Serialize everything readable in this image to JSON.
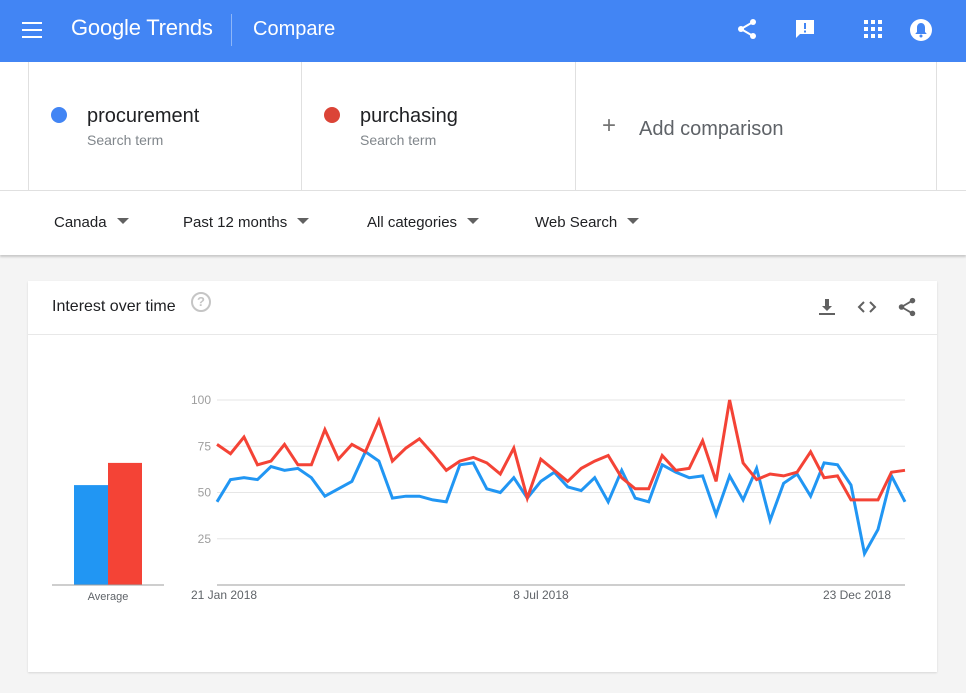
{
  "header": {
    "logo": "Google Trends",
    "title": "Compare",
    "icons": [
      "menu-icon",
      "share-icon",
      "feedback-icon",
      "apps-icon",
      "notifications-icon"
    ]
  },
  "terms": [
    {
      "name": "procurement",
      "subtitle": "Search term",
      "color": "#4285f4"
    },
    {
      "name": "purchasing",
      "subtitle": "Search term",
      "color": "#db4437"
    }
  ],
  "add_comparison": {
    "label": "Add comparison",
    "icon": "plus-icon"
  },
  "filters": {
    "region": "Canada",
    "time": "Past 12 months",
    "category": "All categories",
    "search_type": "Web Search"
  },
  "card": {
    "title": "Interest over time",
    "icons": [
      "help-icon",
      "download-icon",
      "embed-icon",
      "share-icon"
    ]
  },
  "chart_data": {
    "type": "line",
    "yticks": [
      25,
      50,
      75,
      100
    ],
    "ylim": [
      0,
      100
    ],
    "x_labels": [
      "21 Jan 2018",
      "8 Jul 2018",
      "23 Dec 2018"
    ],
    "average_label": "Average",
    "averages": [
      {
        "name": "procurement",
        "value": 54,
        "color": "#2196f3"
      },
      {
        "name": "purchasing",
        "value": 66,
        "color": "#f44336"
      }
    ],
    "series": [
      {
        "name": "procurement",
        "color": "#2196f3",
        "values": [
          45,
          57,
          58,
          57,
          64,
          62,
          63,
          58,
          48,
          52,
          56,
          72,
          67,
          47,
          48,
          48,
          46,
          45,
          65,
          66,
          52,
          50,
          58,
          47,
          56,
          61,
          53,
          51,
          58,
          45,
          62,
          47,
          45,
          65,
          61,
          58,
          59,
          38,
          59,
          46,
          63,
          35,
          55,
          60,
          48,
          66,
          65,
          54,
          17,
          30,
          59,
          45
        ]
      },
      {
        "name": "purchasing",
        "color": "#f44336",
        "values": [
          76,
          71,
          80,
          65,
          67,
          76,
          65,
          65,
          84,
          68,
          76,
          72,
          89,
          67,
          74,
          79,
          71,
          62,
          67,
          69,
          66,
          60,
          74,
          47,
          68,
          62,
          56,
          63,
          67,
          70,
          58,
          52,
          52,
          70,
          62,
          63,
          78,
          56,
          100,
          66,
          57,
          60,
          59,
          61,
          72,
          58,
          59,
          46,
          46,
          46,
          61,
          62
        ]
      }
    ]
  }
}
